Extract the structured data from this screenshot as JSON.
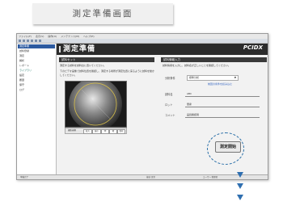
{
  "page": {
    "caption": "測定準備画面"
  },
  "window": {
    "menu": [
      "ファイル(F)",
      "表示(V)",
      "操作(O)",
      "メンテナンス(M)",
      "ヘルプ(H)"
    ],
    "banner_title": "測定準備",
    "logo": "PCIDX",
    "sidebar_items": [
      {
        "label": "測定準備",
        "state": "selected"
      },
      {
        "label": "試料登録",
        "state": "normal"
      },
      {
        "label": "測定",
        "state": "normal"
      },
      {
        "label": "解析",
        "state": "normal"
      },
      {
        "label": "レポート",
        "state": "normal"
      },
      {
        "label": "ライブラリ",
        "state": "teal"
      },
      {
        "label": "設定",
        "state": "normal"
      },
      {
        "label": "履歴",
        "state": "normal"
      },
      {
        "label": "保守",
        "state": "normal"
      },
      {
        "label": "ログ",
        "state": "normal"
      }
    ],
    "left_panel": {
      "heading": "試料セット",
      "line1": "測定する試料を試料台に置いてください。",
      "line2": "下のビデオ画像で試料位置を確認し、測定する場所が測定位置に来るように試料を動かしてください。",
      "cam_buttons": [
        "拡大",
        "縮小",
        "明",
        "暗",
        "保存"
      ],
      "cam_label": "撮影画像"
    },
    "right_panel": {
      "heading": "試料情報入力",
      "note": "試料情報を入力し、試料名が正しいことを確認してください。",
      "fields": [
        {
          "label": "分析条件",
          "value": "標準分析"
        },
        {
          "label": "試料名",
          "value": "ABC"
        },
        {
          "label": "ロット",
          "value": "量産"
        },
        {
          "label": "コメント",
          "value": "品質確認用"
        }
      ],
      "link": "前回の条件を読み込む"
    },
    "start_button": "測定開始",
    "status": [
      "準備完了",
      "接続:正常",
      "ユーザー:管理者"
    ]
  },
  "colors": {
    "banner": "#2b2b2b",
    "selected": "#2c5aa0",
    "accent": "#2f6fb0"
  }
}
